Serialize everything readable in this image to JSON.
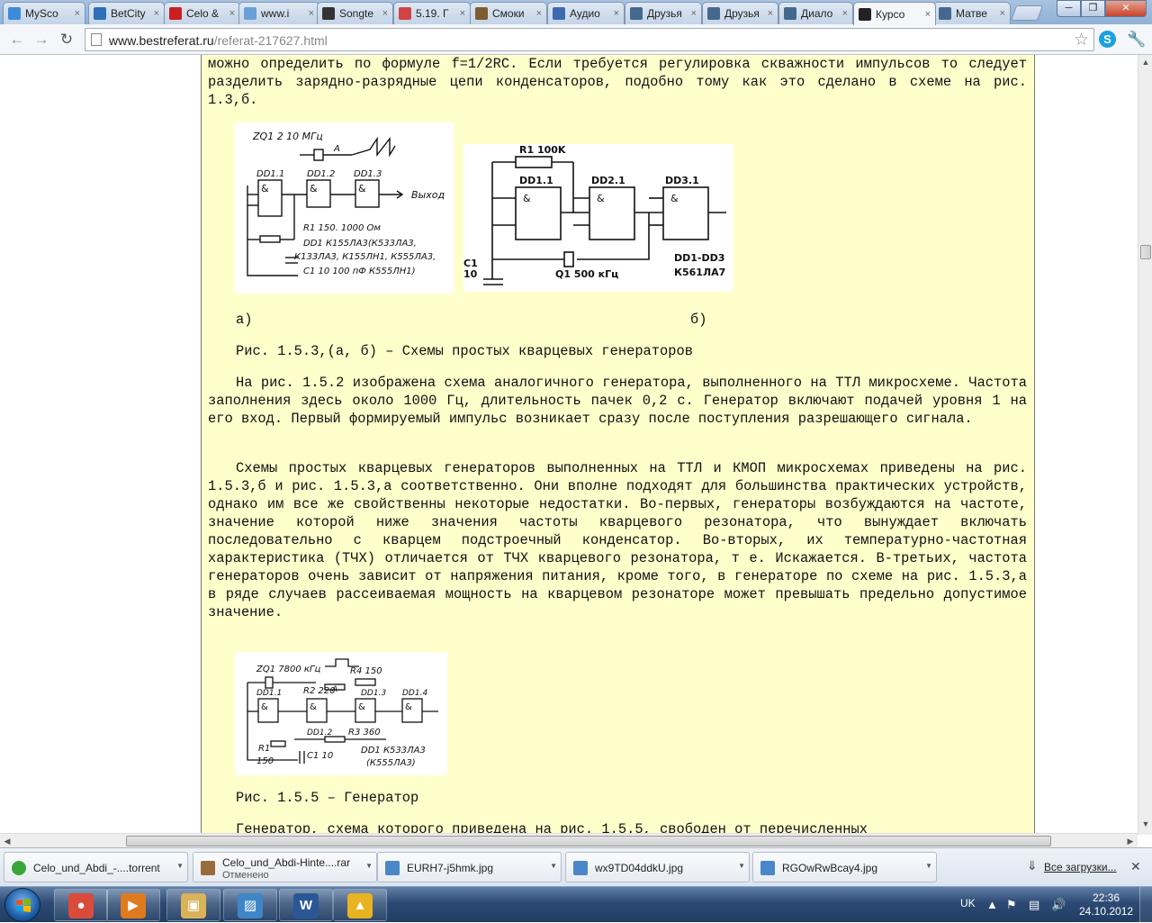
{
  "browser": {
    "tabs": [
      {
        "title": "MySco",
        "icon": "refresh-icon",
        "color": "#3b8bd9"
      },
      {
        "title": "BetCity",
        "icon": "betcity-icon",
        "color": "#2e6fb7"
      },
      {
        "title": "Celo &",
        "icon": "youtube-icon",
        "color": "#cc1f1f"
      },
      {
        "title": "www.i",
        "icon": "web-icon",
        "color": "#6aa0d8"
      },
      {
        "title": "Songte",
        "icon": "songte-icon",
        "color": "#333333"
      },
      {
        "title": "5.19. Г",
        "icon": "document-icon",
        "color": "#d04444"
      },
      {
        "title": "Смоки",
        "icon": "music-icon",
        "color": "#7b5d2e"
      },
      {
        "title": "Аудио",
        "icon": "audio-icon",
        "color": "#3e6bb0"
      },
      {
        "title": "Друзья",
        "icon": "vk-icon",
        "color": "#45688e"
      },
      {
        "title": "Друзья",
        "icon": "vk-icon",
        "color": "#45688e"
      },
      {
        "title": "Диало",
        "icon": "chat-icon",
        "color": "#45688e"
      },
      {
        "title": "Курсо",
        "icon": "graduation-cap-icon",
        "color": "#222222"
      },
      {
        "title": "Матве",
        "icon": "vk-icon",
        "color": "#45688e"
      }
    ],
    "url_domain": "www.bestreferat.ru",
    "url_path": "/referat-217627.html"
  },
  "article": {
    "para_top": "можно определить по формуле f=1/2RC. Если требуется регулировка скважности импульсов то следует разделить зарядно-разрядные цепи конденсаторов, подобно тому как это сделано в схеме на рис. 1.3,б.",
    "label_a": "а)",
    "label_b": "б)",
    "caption_1": "Рис. 1.5.3,(а, б) – Схемы простых кварцевых генераторов",
    "para_2": "На рис. 1.5.2 изображена схема аналогичного генератора, выполненного на ТТЛ микросхеме. Частота заполнения здесь около 1000 Гц, длительность пачек 0,2 с. Генератор включают подачей уровня 1 на его вход. Первый формируемый импульс возникает сразу после поступления разрешающего сигнала.",
    "para_3": "Схемы простых кварцевых генераторов выполненных на ТТЛ и КМОП микросхемах приведены на рис. 1.5.3,б и рис. 1.5.3,а соответственно. Они вполне подходят для большинства практических устройств, однако им все же свойственны некоторые недостатки. Во-первых, генераторы возбуждаются на частоте, значение которой ниже значения частоты кварцевого резонатора, что вынуждает включать последовательно с кварцем подстроечный конденсатор. Во-вторых, их температурно-частотная характеристика (ТЧХ) отличается от ТЧХ кварцевого резонатора, т е. Искажается. В-третьих, частота генераторов очень зависит от напряжения питания, кроме того, в генераторе по схеме на рис. 1.5.3,а в ряде случаев рассеиваемая мощность на кварцевом резонаторе может превышать предельно допустимое значение.",
    "caption_2": "Рис. 1.5.5 – Генератор",
    "para_4": "Генератор, схема которого приведена на рис. 1.5.5, свободен от перечисленных",
    "fig_a": {
      "zq": "ZQ1  2  10 МГц",
      "point_a": "A",
      "dd1": "DD1.1",
      "dd2": "DD1.2",
      "dd3": "DD1.3",
      "out": "Выход",
      "r1": "R1  150.  1000 Ом",
      "chip1": "DD1  К155ЛА3(К533ЛА3,",
      "chip2": "К133ЛА3, К155ЛН1, К555ЛА3,",
      "c1": "C1  10  100 пФ   К555ЛН1)",
      "and": "&"
    },
    "fig_b": {
      "r1": "R1 100K",
      "dd1": "DD1.1",
      "dd2": "DD2.1",
      "dd3": "DD3.1",
      "c1": "C1",
      "c1v": "10",
      "q1": "Q1 500 кГц",
      "chips": "DD1-DD3",
      "chip": "К561ЛА7",
      "and": "&"
    },
    "fig_c": {
      "zq": "ZQ1  7800 кГц",
      "r4": "R4  150",
      "r2": "R2  220",
      "dd1": "DD1.1",
      "dd2": "DD1.2",
      "dd3": "DD1.3",
      "dd4": "DD1.4",
      "r3": "R3  360",
      "r1": "R1",
      "r1v": "150",
      "c1": "C1  10",
      "chip1": "DD1  К533ЛА3",
      "chip2": "(К555ЛА3)",
      "point_a": "A",
      "and": "&"
    }
  },
  "downloads": [
    {
      "name": "Celo_und_Abdi_-....torrent",
      "status": ""
    },
    {
      "name": "Celo_und_Abdi-Hinte....rar",
      "status": "Отменено"
    },
    {
      "name": "EURH7-j5hmk.jpg",
      "status": ""
    },
    {
      "name": "wx9TD04ddkU.jpg",
      "status": ""
    },
    {
      "name": "RGOwRwBcay4.jpg",
      "status": ""
    }
  ],
  "all_downloads": "Все загрузки...",
  "taskbar": {
    "apps": [
      {
        "icon": "chrome-icon",
        "color": "#d94b3b"
      },
      {
        "icon": "media-player-icon",
        "color": "#e07a1f"
      },
      {
        "icon": "explorer-icon",
        "color": "#d9b35a"
      },
      {
        "icon": "photo-viewer-icon",
        "color": "#3f86c8"
      },
      {
        "icon": "word-icon",
        "color": "#2b5797"
      },
      {
        "icon": "daemon-tools-icon",
        "color": "#e8b320"
      }
    ],
    "lang": "UK",
    "time": "22:36",
    "date": "24.10.2012"
  }
}
